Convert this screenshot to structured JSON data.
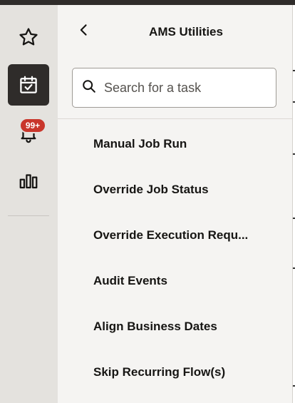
{
  "nav_rail": {
    "items": [
      {
        "name": "favorites",
        "icon": "star-icon",
        "active": false
      },
      {
        "name": "tasks",
        "icon": "calendar-check-icon",
        "active": true
      },
      {
        "name": "notifications",
        "icon": "bell-icon",
        "active": false,
        "badge": "99+"
      },
      {
        "name": "analytics",
        "icon": "bar-chart-icon",
        "active": false
      }
    ]
  },
  "panel": {
    "title": "AMS Utilities",
    "back_icon": "chevron-left-icon",
    "search": {
      "placeholder": "Search for a task",
      "value": "",
      "icon": "search-icon"
    },
    "tasks": [
      "Manual Job Run",
      "Override Job Status",
      "Override Execution Requ...",
      "Audit Events",
      "Align Business Dates",
      "Skip Recurring Flow(s)"
    ]
  },
  "colors": {
    "rail_bg": "#e4e2de",
    "active_bg": "#2f2c2a",
    "panel_bg": "#f5f4f2",
    "badge_bg": "#c9362b",
    "text": "#161513"
  }
}
